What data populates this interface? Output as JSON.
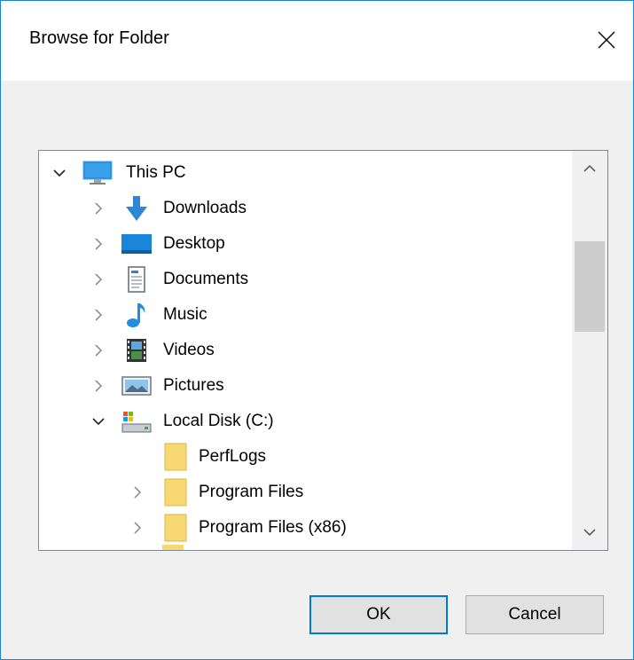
{
  "window": {
    "title": "Browse for Folder"
  },
  "tree": {
    "items": [
      {
        "label": "This PC",
        "expanded": true,
        "icon": "monitor-icon"
      },
      {
        "label": "Downloads",
        "expanded": false,
        "icon": "download-arrow-icon"
      },
      {
        "label": "Desktop",
        "expanded": false,
        "icon": "desktop-icon"
      },
      {
        "label": "Documents",
        "expanded": false,
        "icon": "document-icon"
      },
      {
        "label": "Music",
        "expanded": false,
        "icon": "music-note-icon"
      },
      {
        "label": "Videos",
        "expanded": false,
        "icon": "film-icon"
      },
      {
        "label": "Pictures",
        "expanded": false,
        "icon": "picture-icon"
      },
      {
        "label": "Local Disk (C:)",
        "expanded": true,
        "icon": "drive-icon"
      },
      {
        "label": "PerfLogs",
        "icon": "folder-icon"
      },
      {
        "label": "Program Files",
        "expanded": false,
        "icon": "folder-icon"
      },
      {
        "label": "Program Files (x86)",
        "expanded": false,
        "icon": "folder-icon"
      }
    ]
  },
  "buttons": {
    "ok": "OK",
    "cancel": "Cancel"
  },
  "colors": {
    "accent": "#0078d7",
    "folder": "#f8d775"
  }
}
